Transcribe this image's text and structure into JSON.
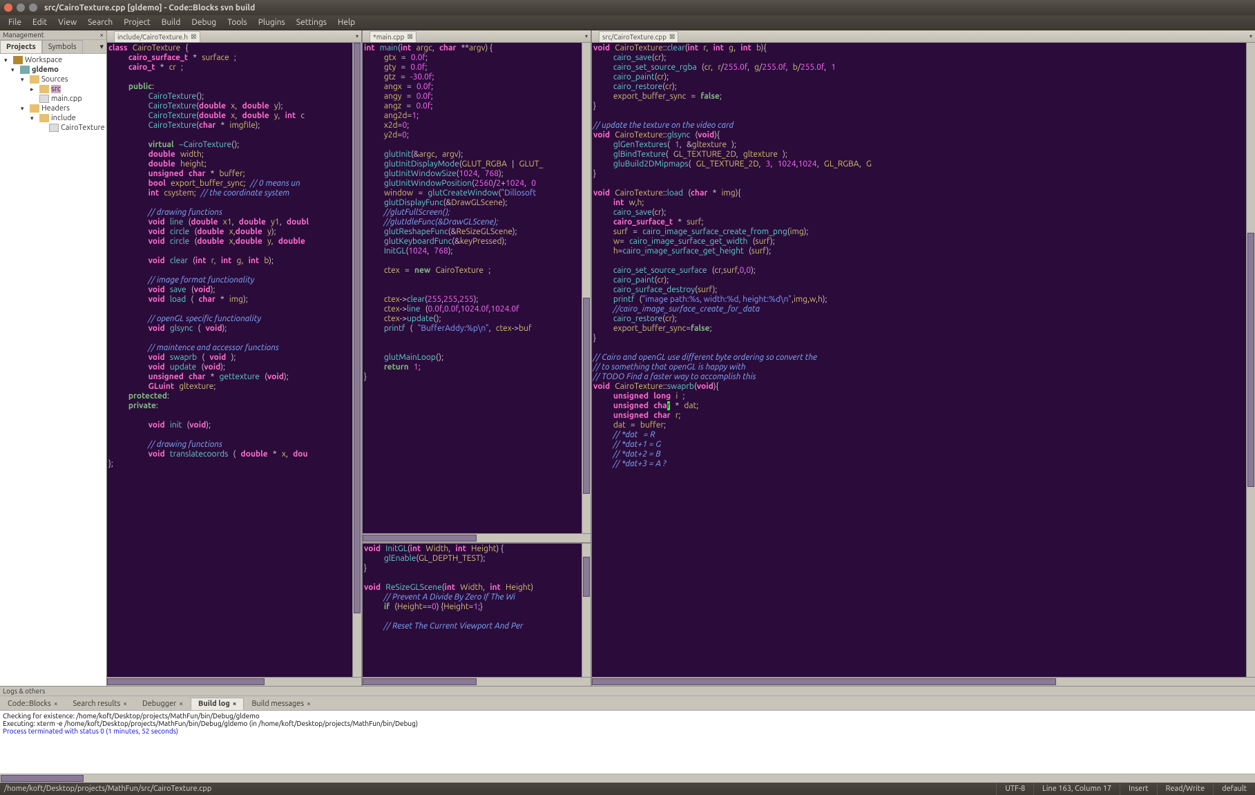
{
  "window": {
    "title": "src/CairoTexture.cpp [gldemo] - Code::Blocks svn build"
  },
  "menubar": [
    "File",
    "Edit",
    "View",
    "Search",
    "Project",
    "Build",
    "Debug",
    "Tools",
    "Plugins",
    "Settings",
    "Help"
  ],
  "sidebar": {
    "header": "Management",
    "tabs": {
      "projects": "Projects",
      "symbols": "Symbols"
    },
    "tree": {
      "workspace": "Workspace",
      "project": "gldemo",
      "sources": "Sources",
      "srcfolder": "src",
      "maincpp": "main.cpp",
      "headers": "Headers",
      "include": "include",
      "cairoh": "CairoTexture"
    }
  },
  "editor_tabs": {
    "tab1": "include/CairoTexture.h",
    "tab2": "*main.cpp",
    "tab3": "src/CairoTexture.cpp"
  },
  "log_panel": {
    "header": "Logs & others",
    "tabs": [
      "Code::Blocks",
      "Search results",
      "Debugger",
      "Build log",
      "Build messages"
    ],
    "line1": "Checking for existence: /home/koft/Desktop/projects/MathFun/bin/Debug/gldemo",
    "line2": "Executing: xterm -e /home/koft/Desktop/projects/MathFun/bin/Debug/gldemo  (in /home/koft/Desktop/projects/MathFun/bin/Debug)",
    "line3": "Process terminated with status 0 (1 minutes, 52 seconds)"
  },
  "statusbar": {
    "path": "/home/koft/Desktop/projects/MathFun/src/CairoTexture.cpp",
    "encoding": "UTF-8",
    "pos": "Line 163, Column 17",
    "insert": "Insert",
    "rw": "Read/Write",
    "eol": "default"
  },
  "code": {
    "pane1": "<span class='ty'>class</span> <span class='id'>CairoTexture</span> <span class='sc'>{</span>\n    <span class='ty'>cairo_surface_t</span> <span class='op'>*</span> <span class='id'>surface</span> <span class='sc'>;</span>\n    <span class='ty'>cairo_t</span> <span class='op'>*</span> <span class='id'>cr</span> <span class='sc'>;</span>\n\n    <span class='kw'>public</span><span class='sc'>:</span>\n        <span class='fn'>CairoTexture</span><span class='sc'>();</span>\n        <span class='fn'>CairoTexture</span><span class='sc'>(</span><span class='ty'>double</span> <span class='id'>x</span><span class='sc'>,</span> <span class='ty'>double</span> <span class='id'>y</span><span class='sc'>);</span>\n        <span class='fn'>CairoTexture</span><span class='sc'>(</span><span class='ty'>double</span> <span class='id'>x</span><span class='sc'>,</span> <span class='ty'>double</span> <span class='id'>y</span><span class='sc'>,</span> <span class='ty'>int</span> <span class='id'>c</span>\n        <span class='fn'>CairoTexture</span><span class='sc'>(</span><span class='ty'>char</span> <span class='op'>*</span> <span class='id'>imgfile</span><span class='sc'>);</span>\n\n        <span class='kw'>virtual</span> <span class='fn'>~CairoTexture</span><span class='sc'>();</span>\n        <span class='ty'>double</span> <span class='id'>width</span><span class='sc'>;</span>\n        <span class='ty'>double</span> <span class='id'>height</span><span class='sc'>;</span>\n        <span class='ty'>unsigned</span> <span class='ty'>char</span> <span class='op'>*</span> <span class='id'>buffer</span><span class='sc'>;</span>\n        <span class='ty'>bool</span> <span class='id'>export_buffer_sync</span><span class='sc'>;</span> <span class='cm'>// 0 means un</span>\n        <span class='ty'>int</span> <span class='id'>csystem</span><span class='sc'>;</span> <span class='cm'>// the coordinate system</span>\n\n        <span class='cm'>// drawing functions</span>\n        <span class='ty'>void</span> <span class='fn'>line</span> <span class='sc'>(</span><span class='ty'>double</span> <span class='id'>x1</span><span class='sc'>,</span> <span class='ty'>double</span> <span class='id'>y1</span><span class='sc'>,</span> <span class='ty'>doubl</span>\n        <span class='ty'>void</span> <span class='fn'>circle</span> <span class='sc'>(</span><span class='ty'>double</span> <span class='id'>x</span><span class='sc'>,</span><span class='ty'>double</span> <span class='id'>y</span><span class='sc'>);</span>\n        <span class='ty'>void</span> <span class='fn'>circle</span> <span class='sc'>(</span><span class='ty'>double</span> <span class='id'>x</span><span class='sc'>,</span><span class='ty'>double</span> <span class='id'>y</span><span class='sc'>,</span> <span class='ty'>double</span>\n\n        <span class='ty'>void</span> <span class='fn'>clear</span> <span class='sc'>(</span><span class='ty'>int</span> <span class='id'>r</span><span class='sc'>,</span> <span class='ty'>int</span> <span class='id'>g</span><span class='sc'>,</span> <span class='ty'>int</span> <span class='id'>b</span><span class='sc'>);</span>\n\n        <span class='cm'>// image format functionality</span>\n        <span class='ty'>void</span> <span class='fn'>save</span> <span class='sc'>(</span><span class='ty'>void</span><span class='sc'>);</span>\n        <span class='ty'>void</span> <span class='fn'>load</span> <span class='sc'>(</span> <span class='ty'>char</span> <span class='op'>*</span> <span class='id'>img</span><span class='sc'>);</span>\n\n        <span class='cm'>// openGL specific functionality</span>\n        <span class='ty'>void</span> <span class='fn'>glsync</span> <span class='sc'>(</span> <span class='ty'>void</span><span class='sc'>);</span>\n\n        <span class='cm'>// maintence and accessor functions</span>\n        <span class='ty'>void</span> <span class='fn'>swaprb</span> <span class='sc'>(</span> <span class='ty'>void</span> <span class='sc'>);</span>\n        <span class='ty'>void</span> <span class='fn'>update</span> <span class='sc'>(</span><span class='ty'>void</span><span class='sc'>);</span>\n        <span class='ty'>unsigned</span> <span class='ty'>char</span> <span class='op'>*</span> <span class='fn'>gettexture</span> <span class='sc'>(</span><span class='ty'>void</span><span class='sc'>);</span>\n        <span class='ty'>GLuint</span> <span class='id'>gltexture</span><span class='sc'>;</span>\n    <span class='kw'>protected</span><span class='sc'>:</span>\n    <span class='kw'>private</span><span class='sc'>:</span>\n\n        <span class='ty'>void</span> <span class='fn'>init</span> <span class='sc'>(</span><span class='ty'>void</span><span class='sc'>);</span>\n\n        <span class='cm'>// drawing functions</span>\n        <span class='ty'>void</span> <span class='fn'>translatecoords</span> <span class='sc'>(</span> <span class='ty'>double</span> <span class='op'>*</span> <span class='id'>x</span><span class='sc'>,</span> <span class='ty'>dou</span>\n<span class='sc'>};</span>",
    "pane2a": "<span class='ty'>int</span> <span class='fn'>main</span><span class='sc'>(</span><span class='ty'>int</span> <span class='id'>argc</span><span class='sc'>,</span> <span class='ty'>char</span> <span class='op'>**</span><span class='id'>argv</span><span class='sc'>) {</span>\n    <span class='id'>gtx</span> <span class='op'>=</span> <span class='num'>0.0f</span><span class='sc'>;</span>\n    <span class='id'>gty</span> <span class='op'>=</span> <span class='num'>0.0f</span><span class='sc'>;</span>\n    <span class='id'>gtz</span> <span class='op'>=</span> <span class='num'>-30.0f</span><span class='sc'>;</span>\n    <span class='id'>angx</span> <span class='op'>=</span> <span class='num'>0.0f</span><span class='sc'>;</span>\n    <span class='id'>angy</span> <span class='op'>=</span> <span class='num'>0.0f</span><span class='sc'>;</span>\n    <span class='id'>angz</span> <span class='op'>=</span> <span class='num'>0.0f</span><span class='sc'>;</span>\n    <span class='id'>ang2d</span><span class='op'>=</span><span class='num'>1</span><span class='sc'>;</span>\n    <span class='id'>x2d</span><span class='op'>=</span><span class='num'>0</span><span class='sc'>;</span>\n    <span class='id'>y2d</span><span class='op'>=</span><span class='num'>0</span><span class='sc'>;</span>\n\n    <span class='fn'>glutInit</span><span class='sc'>(</span><span class='op'>&amp;</span><span class='id'>argc</span><span class='sc'>,</span> <span class='id'>argv</span><span class='sc'>);</span>\n    <span class='fn'>glutInitDisplayMode</span><span class='sc'>(</span><span class='id'>GLUT_RGBA</span> <span class='op'>|</span> <span class='id'>GLUT_</span>\n    <span class='fn'>glutInitWindowSize</span><span class='sc'>(</span><span class='num'>1024</span><span class='sc'>,</span> <span class='num'>768</span><span class='sc'>);</span>\n    <span class='fn'>glutInitWindowPosition</span><span class='sc'>(</span><span class='num'>2560</span><span class='op'>/</span><span class='num'>2</span><span class='op'>+</span><span class='num'>1024</span><span class='sc'>,</span> <span class='num'>0</span>\n    <span class='id'>window</span> <span class='op'>=</span> <span class='fn'>glutCreateWindow</span><span class='sc'>(</span><span class='str'>\"Dillosoft</span>\n    <span class='fn'>glutDisplayFunc</span><span class='sc'>(</span><span class='op'>&amp;</span><span class='id'>DrawGLScene</span><span class='sc'>);</span>\n    <span class='cm'>//glutFullScreen();</span>\n    <span class='cm'>//glutIdleFunc(&amp;DrawGLScene);</span>\n    <span class='fn'>glutReshapeFunc</span><span class='sc'>(</span><span class='op'>&amp;</span><span class='id'>ReSizeGLScene</span><span class='sc'>);</span>\n    <span class='fn'>glutKeyboardFunc</span><span class='sc'>(</span><span class='op'>&amp;</span><span class='id'>keyPressed</span><span class='sc'>);</span>\n    <span class='fn'>InitGL</span><span class='sc'>(</span><span class='num'>1024</span><span class='sc'>,</span> <span class='num'>768</span><span class='sc'>);</span>\n\n    <span class='id'>ctex</span> <span class='op'>=</span> <span class='kw'>new</span> <span class='id'>CairoTexture</span> <span class='sc'>;</span>\n\n\n    <span class='id'>ctex</span><span class='op'>-&gt;</span><span class='fn'>clear</span><span class='sc'>(</span><span class='num'>255</span><span class='sc'>,</span><span class='num'>255</span><span class='sc'>,</span><span class='num'>255</span><span class='sc'>);</span>\n    <span class='id'>ctex</span><span class='op'>-&gt;</span><span class='fn'>line</span> <span class='sc'>(</span><span class='num'>0.0f</span><span class='sc'>,</span><span class='num'>0.0f</span><span class='sc'>,</span><span class='num'>1024.0f</span><span class='sc'>,</span><span class='num'>1024.0f</span>\n    <span class='id'>ctex</span><span class='op'>-&gt;</span><span class='fn'>update</span><span class='sc'>();</span>\n    <span class='fn'>printf</span> <span class='sc'>(</span> <span class='str'>\"BufferAddy:%p\\n\"</span><span class='sc'>,</span> <span class='id'>ctex</span><span class='op'>-&gt;</span><span class='id'>buf</span>\n\n\n    <span class='fn'>glutMainLoop</span><span class='sc'>();</span>\n    <span class='kw'>return</span> <span class='num'>1</span><span class='sc'>;</span>\n<span class='sc'>}</span>",
    "pane2b": "<span class='ty'>void</span> <span class='fn'>InitGL</span><span class='sc'>(</span><span class='ty'>int</span> <span class='id'>Width</span><span class='sc'>,</span> <span class='ty'>int</span> <span class='id'>Height</span><span class='sc'>) {</span>\n    <span class='fn'>glEnable</span><span class='sc'>(</span><span class='id'>GL_DEPTH_TEST</span><span class='sc'>);</span>\n<span class='sc'>}</span>\n\n<span class='ty'>void</span> <span class='fn'>ReSizeGLScene</span><span class='sc'>(</span><span class='ty'>int</span> <span class='id'>Width</span><span class='sc'>,</span> <span class='ty'>int</span> <span class='id'>Height</span><span class='sc'>)</span>\n    <span class='cm'>// Prevent A Divide By Zero If The Wi</span>\n    <span class='kw'>if</span> <span class='sc'>(</span><span class='id'>Height</span><span class='op'>==</span><span class='num'>0</span><span class='sc'>) {</span><span class='id'>Height</span><span class='op'>=</span><span class='num'>1</span><span class='sc'>;}</span>\n\n    <span class='cm'>// Reset The Current Viewport And Per</span>",
    "pane3": "<span class='ty'>void</span> <span class='id'>CairoTexture</span><span class='op'>::</span><span class='fn'>clear</span><span class='sc'>(</span><span class='ty'>int</span> <span class='id'>r</span><span class='sc'>,</span> <span class='ty'>int</span> <span class='id'>g</span><span class='sc'>,</span> <span class='ty'>int</span> <span class='id'>b</span><span class='sc'>){</span>\n    <span class='fn'>cairo_save</span><span class='sc'>(</span><span class='id'>cr</span><span class='sc'>);</span>\n    <span class='fn'>cairo_set_source_rgba</span> <span class='sc'>(</span><span class='id'>cr</span><span class='sc'>,</span> <span class='id'>r</span><span class='op'>/</span><span class='num'>255.0f</span><span class='sc'>,</span> <span class='id'>g</span><span class='op'>/</span><span class='num'>255.0f</span><span class='sc'>,</span> <span class='id'>b</span><span class='op'>/</span><span class='num'>255.0f</span><span class='sc'>,</span> <span class='num'>1</span>\n    <span class='fn'>cairo_paint</span><span class='sc'>(</span><span class='id'>cr</span><span class='sc'>);</span>\n    <span class='fn'>cairo_restore</span><span class='sc'>(</span><span class='id'>cr</span><span class='sc'>);</span>\n    <span class='id'>export_buffer_sync</span> <span class='op'>=</span> <span class='kw'>false</span><span class='sc'>;</span>\n<span class='sc'>}</span>\n\n<span class='cm'>// update the texture on the video card</span>\n<span class='ty'>void</span> <span class='id'>CairoTexture</span><span class='op'>::</span><span class='fn'>glsync</span> <span class='sc'>(</span><span class='ty'>void</span><span class='sc'>){</span>\n    <span class='fn'>glGenTextures</span><span class='sc'>(</span> <span class='num'>1</span><span class='sc'>,</span> <span class='op'>&amp;</span><span class='id'>gltexture</span> <span class='sc'>);</span>\n    <span class='fn'>glBindTexture</span><span class='sc'>(</span> <span class='id'>GL_TEXTURE_2D</span><span class='sc'>,</span> <span class='id'>gltexture</span> <span class='sc'>);</span>\n    <span class='fn'>gluBuild2DMipmaps</span><span class='sc'>(</span> <span class='id'>GL_TEXTURE_2D</span><span class='sc'>,</span> <span class='num'>3</span><span class='sc'>,</span> <span class='num'>1024</span><span class='sc'>,</span><span class='num'>1024</span><span class='sc'>,</span> <span class='id'>GL_RGBA</span><span class='sc'>,</span> <span class='id'>G</span>\n<span class='sc'>}</span>\n\n<span class='ty'>void</span> <span class='id'>CairoTexture</span><span class='op'>::</span><span class='fn'>load</span> <span class='sc'>(</span><span class='ty'>char</span> <span class='op'>*</span> <span class='id'>img</span><span class='sc'>){</span>\n    <span class='ty'>int</span> <span class='id'>w</span><span class='sc'>,</span><span class='id'>h</span><span class='sc'>;</span>\n    <span class='fn'>cairo_save</span><span class='sc'>(</span><span class='id'>cr</span><span class='sc'>);</span>\n    <span class='ty'>cairo_surface_t</span> <span class='op'>*</span> <span class='id'>surf</span><span class='sc'>;</span>\n    <span class='id'>surf</span> <span class='op'>=</span> <span class='fn'>cairo_image_surface_create_from_png</span><span class='sc'>(</span><span class='id'>img</span><span class='sc'>);</span>\n    <span class='id'>w</span><span class='op'>=</span> <span class='fn'>cairo_image_surface_get_width</span> <span class='sc'>(</span><span class='id'>surf</span><span class='sc'>);</span>\n    <span class='id'>h</span><span class='op'>=</span><span class='fn'>cairo_image_surface_get_height</span> <span class='sc'>(</span><span class='id'>surf</span><span class='sc'>);</span>\n\n    <span class='fn'>cairo_set_source_surface</span> <span class='sc'>(</span><span class='id'>cr</span><span class='sc'>,</span><span class='id'>surf</span><span class='sc'>,</span><span class='num'>0</span><span class='sc'>,</span><span class='num'>0</span><span class='sc'>);</span>\n    <span class='fn'>cairo_paint</span><span class='sc'>(</span><span class='id'>cr</span><span class='sc'>);</span>\n    <span class='fn'>cairo_surface_destroy</span><span class='sc'>(</span><span class='id'>surf</span><span class='sc'>);</span>\n    <span class='fn'>printf</span> <span class='sc'>(</span><span class='str'>\"image path:%s, width:%d, height:%d\\n\"</span><span class='sc'>,</span><span class='id'>img</span><span class='sc'>,</span><span class='id'>w</span><span class='sc'>,</span><span class='id'>h</span><span class='sc'>);</span>\n    <span class='cm'>//cairo_image_surface_create_for_data</span>\n    <span class='fn'>cairo_restore</span><span class='sc'>(</span><span class='id'>cr</span><span class='sc'>);</span>\n    <span class='id'>export_buffer_sync</span><span class='op'>=</span><span class='kw'>false</span><span class='sc'>;</span>\n<span class='sc'>}</span>\n\n<span class='cm'>// Cairo and openGL use different byte ordering so convert the</span>\n<span class='cm'>// to something that openGL is happy with</span>\n<span class='cm'>// TODO Find a faster way to accomplish this</span>\n<span class='ty'>void</span> <span class='id'>CairoTexture</span><span class='op'>::</span><span class='fn'>swaprb</span><span class='sc'>(</span><span class='ty'>void</span><span class='sc'>){</span>\n    <span class='ty'>unsigned</span> <span class='ty'>long</span> <span class='id'>i</span> <span class='sc'>;</span>\n    <span class='ty'>unsigned</span> <span class='ty'>cha</span><span class='hl'>r</span> <span class='op'>*</span> <span class='id'>dat</span><span class='sc'>;</span>\n    <span class='ty'>unsigned</span> <span class='ty'>char</span> <span class='id'>r</span><span class='sc'>;</span>\n    <span class='id'>dat</span> <span class='op'>=</span> <span class='id'>buffer</span><span class='sc'>;</span>\n    <span class='cm'>// *dat   = R</span>\n    <span class='cm'>// *dat+1 = G</span>\n    <span class='cm'>// *dat+2 = B</span>\n    <span class='cm'>// *dat+3 = A ?</span>"
  }
}
